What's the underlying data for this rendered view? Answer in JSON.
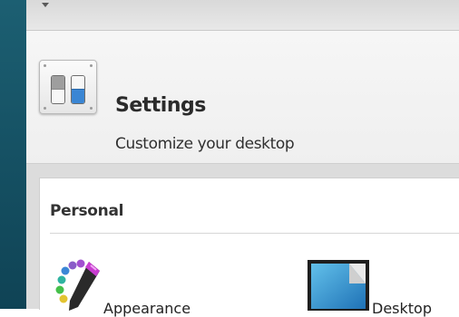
{
  "header": {
    "title": "Settings",
    "subtitle": "Customize your desktop",
    "icon": "settings-toggle-icon"
  },
  "section": {
    "title": "Personal",
    "items": [
      {
        "label": "Appearance",
        "icon": "palette-brush-icon"
      },
      {
        "label": "Desktop",
        "icon": "desktop-wallpaper-icon"
      }
    ]
  },
  "colors": {
    "desktop": "#175366",
    "toggle_active": "#3a86d4"
  }
}
